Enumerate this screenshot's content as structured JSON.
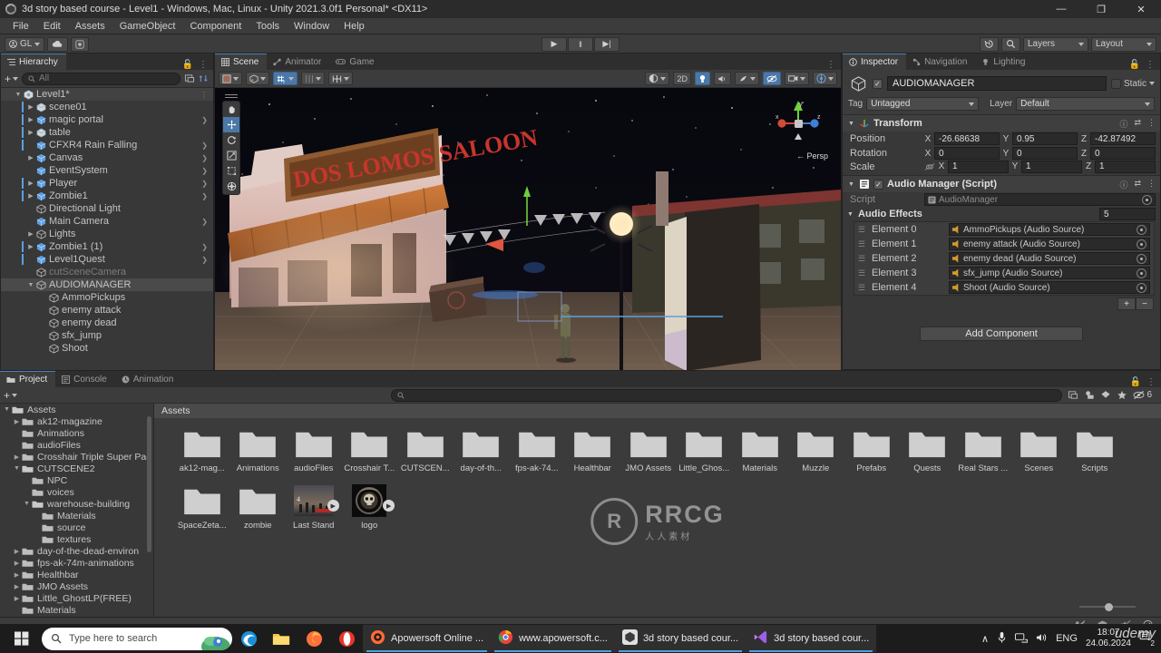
{
  "window": {
    "title": "3d story based course - Level1 - Windows, Mac, Linux - Unity 2021.3.0f1 Personal* <DX11>",
    "minimize": "—",
    "maximize": "❐",
    "close": "✕"
  },
  "menubar": [
    "File",
    "Edit",
    "Assets",
    "GameObject",
    "Component",
    "Tools",
    "Window",
    "Help"
  ],
  "toolbar": {
    "account": "GL",
    "cloud_icon": "cloud-icon",
    "services_icon": "services-icon",
    "play": "▶",
    "pause": "‖",
    "step": "▶|",
    "history_icon": "history-icon",
    "search_icon": "search-icon",
    "layers": "Layers",
    "layout": "Layout"
  },
  "hierarchy": {
    "tab": "Hierarchy",
    "tab_icon": "hierarchy-icon",
    "add_label": "+",
    "search_placeholder": "All",
    "items": [
      {
        "label": "Level1*",
        "depth": 0,
        "icon": "scene-icon",
        "arrow": "▼",
        "selected": false,
        "root": true,
        "chevron": false,
        "prefab": false,
        "dim": false,
        "bluebar": false
      },
      {
        "label": "scene01",
        "depth": 1,
        "icon": "prefab-icon",
        "arrow": "▶",
        "selected": false,
        "chevron": false,
        "prefab": true,
        "dim": false,
        "bluebar": true
      },
      {
        "label": "magic portal",
        "depth": 1,
        "icon": "gameobject-icon",
        "arrow": "▶",
        "selected": false,
        "chevron": true,
        "prefab": false,
        "dim": false,
        "bluebar": true
      },
      {
        "label": "table",
        "depth": 1,
        "icon": "prefab-icon",
        "arrow": "▶",
        "selected": false,
        "chevron": false,
        "prefab": true,
        "dim": false,
        "bluebar": true
      },
      {
        "label": "CFXR4 Rain Falling",
        "depth": 1,
        "icon": "gameobject-icon",
        "arrow": "",
        "selected": false,
        "chevron": true,
        "prefab": false,
        "dim": false,
        "bluebar": true
      },
      {
        "label": "Canvas",
        "depth": 1,
        "icon": "gameobject-icon",
        "arrow": "▶",
        "selected": false,
        "chevron": true,
        "prefab": false,
        "dim": false,
        "bluebar": false
      },
      {
        "label": "EventSystem",
        "depth": 1,
        "icon": "gameobject-icon",
        "arrow": "",
        "selected": false,
        "chevron": true,
        "prefab": false,
        "dim": false,
        "bluebar": false
      },
      {
        "label": "Player",
        "depth": 1,
        "icon": "gameobject-icon",
        "arrow": "▶",
        "selected": false,
        "chevron": true,
        "prefab": false,
        "dim": false,
        "bluebar": true
      },
      {
        "label": "Zombie1",
        "depth": 1,
        "icon": "gameobject-icon",
        "arrow": "▶",
        "selected": false,
        "chevron": true,
        "prefab": false,
        "dim": false,
        "bluebar": true
      },
      {
        "label": "Directional Light",
        "depth": 1,
        "icon": "empty-icon",
        "arrow": "",
        "selected": false,
        "chevron": false,
        "prefab": false,
        "dim": false,
        "bluebar": false
      },
      {
        "label": "Main Camera",
        "depth": 1,
        "icon": "gameobject-icon",
        "arrow": "",
        "selected": false,
        "chevron": true,
        "prefab": false,
        "dim": false,
        "bluebar": false
      },
      {
        "label": "Lights",
        "depth": 1,
        "icon": "empty-icon",
        "arrow": "▶",
        "selected": false,
        "chevron": false,
        "prefab": false,
        "dim": false,
        "bluebar": false
      },
      {
        "label": "Zombie1 (1)",
        "depth": 1,
        "icon": "gameobject-icon",
        "arrow": "▶",
        "selected": false,
        "chevron": true,
        "prefab": false,
        "dim": false,
        "bluebar": true
      },
      {
        "label": "Level1Quest",
        "depth": 1,
        "icon": "gameobject-icon",
        "arrow": "",
        "selected": false,
        "chevron": true,
        "prefab": false,
        "dim": false,
        "bluebar": true
      },
      {
        "label": "cutSceneCamera",
        "depth": 1,
        "icon": "empty-icon",
        "arrow": "",
        "selected": false,
        "chevron": false,
        "prefab": false,
        "dim": true,
        "bluebar": false
      },
      {
        "label": "AUDIOMANAGER",
        "depth": 1,
        "icon": "empty-icon",
        "arrow": "▼",
        "selected": true,
        "chevron": false,
        "prefab": false,
        "dim": false,
        "bluebar": false
      },
      {
        "label": "AmmoPickups",
        "depth": 2,
        "icon": "empty-icon",
        "arrow": "",
        "selected": false,
        "chevron": false,
        "prefab": false,
        "dim": false,
        "bluebar": false
      },
      {
        "label": "enemy attack",
        "depth": 2,
        "icon": "empty-icon",
        "arrow": "",
        "selected": false,
        "chevron": false,
        "prefab": false,
        "dim": false,
        "bluebar": false
      },
      {
        "label": "enemy dead",
        "depth": 2,
        "icon": "empty-icon",
        "arrow": "",
        "selected": false,
        "chevron": false,
        "prefab": false,
        "dim": false,
        "bluebar": false
      },
      {
        "label": "sfx_jump",
        "depth": 2,
        "icon": "empty-icon",
        "arrow": "",
        "selected": false,
        "chevron": false,
        "prefab": false,
        "dim": false,
        "bluebar": false
      },
      {
        "label": "Shoot",
        "depth": 2,
        "icon": "empty-icon",
        "arrow": "",
        "selected": false,
        "chevron": false,
        "prefab": false,
        "dim": false,
        "bluebar": false
      }
    ]
  },
  "scene": {
    "tabs": [
      {
        "label": "Scene",
        "active": true,
        "icon": "scene-tab-icon"
      },
      {
        "label": "Animator",
        "active": false,
        "icon": "animator-tab-icon"
      },
      {
        "label": "Game",
        "active": false,
        "icon": "game-tab-icon"
      }
    ],
    "toolbar": {
      "shading_mode": "shaded-icon",
      "draw_mode": "draw-mode-icon",
      "lighting_toggle": "lighting-icon",
      "audio_toggle": "audio-icon",
      "fx_toggle": "fx-icon",
      "grid_toggle": "grid-icon",
      "two_d": "2D",
      "gizmos": "Gizmos"
    },
    "tools": [
      {
        "icon": "hand-tool",
        "active": false
      },
      {
        "icon": "move-tool",
        "active": true
      },
      {
        "icon": "rotate-tool",
        "active": false
      },
      {
        "icon": "scale-tool",
        "active": false
      },
      {
        "icon": "rect-tool",
        "active": false
      },
      {
        "icon": "transform-tool",
        "active": false
      }
    ],
    "gizmo": {
      "x": "x",
      "y": "y",
      "z": "z",
      "perspective_label": "← Persp"
    },
    "signboard_text": "DOS LOMOS SALOON"
  },
  "inspector": {
    "tabs": [
      {
        "label": "Inspector",
        "active": true,
        "icon": "inspector-icon"
      },
      {
        "label": "Navigation",
        "active": false,
        "icon": "navigation-icon"
      },
      {
        "label": "Lighting",
        "active": false,
        "icon": "lighting-icon"
      }
    ],
    "object_name": "AUDIOMANAGER",
    "static_label": "Static",
    "tag_label": "Tag",
    "tag_value": "Untagged",
    "layer_label": "Layer",
    "layer_value": "Default",
    "transform": {
      "title": "Transform",
      "rows": [
        {
          "label": "Position",
          "x": "-26.68638",
          "y": "0.95",
          "z": "-42.87492"
        },
        {
          "label": "Rotation",
          "x": "0",
          "y": "0",
          "z": "0"
        },
        {
          "label": "Scale",
          "x": "1",
          "y": "1",
          "z": "1"
        }
      ]
    },
    "script_component": {
      "title": "Audio Manager (Script)",
      "script_label": "Script",
      "script_value": "AudioManager",
      "array_label": "Audio Effects",
      "array_size": "5",
      "elements": [
        {
          "label": "Element 0",
          "value": "AmmoPickups (Audio Source)"
        },
        {
          "label": "Element 1",
          "value": "enemy attack (Audio Source)"
        },
        {
          "label": "Element 2",
          "value": "enemy dead (Audio Source)"
        },
        {
          "label": "Element 3",
          "value": "sfx_jump (Audio Source)"
        },
        {
          "label": "Element 4",
          "value": "Shoot (Audio Source)"
        }
      ],
      "add_btn": "+",
      "remove_btn": "−"
    },
    "add_component": "Add Component"
  },
  "project": {
    "tabs": [
      {
        "label": "Project",
        "active": true,
        "icon": "project-icon"
      },
      {
        "label": "Console",
        "active": false,
        "icon": "console-icon"
      },
      {
        "label": "Animation",
        "active": false,
        "icon": "animation-icon"
      }
    ],
    "add_label": "+",
    "search_placeholder": "",
    "filter_count": "6",
    "breadcrumb": "Assets",
    "tree": [
      {
        "label": "Assets",
        "depth": 0,
        "arrow": "▼",
        "open": true
      },
      {
        "label": "ak12-magazine",
        "depth": 1,
        "arrow": "▶",
        "open": false
      },
      {
        "label": "Animations",
        "depth": 1,
        "arrow": "",
        "open": false
      },
      {
        "label": "audioFiles",
        "depth": 1,
        "arrow": "",
        "open": false
      },
      {
        "label": "Crosshair Triple Super Pac",
        "depth": 1,
        "arrow": "▶",
        "open": false
      },
      {
        "label": "CUTSCENE2",
        "depth": 1,
        "arrow": "▼",
        "open": true
      },
      {
        "label": "NPC",
        "depth": 2,
        "arrow": "",
        "open": false
      },
      {
        "label": "voices",
        "depth": 2,
        "arrow": "",
        "open": false
      },
      {
        "label": "warehouse-building",
        "depth": 2,
        "arrow": "▼",
        "open": true
      },
      {
        "label": "Materials",
        "depth": 3,
        "arrow": "",
        "open": false
      },
      {
        "label": "source",
        "depth": 3,
        "arrow": "",
        "open": false
      },
      {
        "label": "textures",
        "depth": 3,
        "arrow": "",
        "open": false
      },
      {
        "label": "day-of-the-dead-environ",
        "depth": 1,
        "arrow": "▶",
        "open": false
      },
      {
        "label": "fps-ak-74m-animations",
        "depth": 1,
        "arrow": "▶",
        "open": false
      },
      {
        "label": "Healthbar",
        "depth": 1,
        "arrow": "▶",
        "open": false
      },
      {
        "label": "JMO Assets",
        "depth": 1,
        "arrow": "▶",
        "open": false
      },
      {
        "label": "Little_GhostLP(FREE)",
        "depth": 1,
        "arrow": "▶",
        "open": false
      },
      {
        "label": "Materials",
        "depth": 1,
        "arrow": "",
        "open": false
      }
    ],
    "assets": [
      {
        "label": "ak12-mag...",
        "type": "folder"
      },
      {
        "label": "Animations",
        "type": "folder"
      },
      {
        "label": "audioFiles",
        "type": "folder"
      },
      {
        "label": "Crosshair T...",
        "type": "folder"
      },
      {
        "label": "CUTSCEN...",
        "type": "folder"
      },
      {
        "label": "day-of-th...",
        "type": "folder"
      },
      {
        "label": "fps-ak-74...",
        "type": "folder"
      },
      {
        "label": "Healthbar",
        "type": "folder"
      },
      {
        "label": "JMO Assets",
        "type": "folder"
      },
      {
        "label": "Little_Ghos...",
        "type": "folder"
      },
      {
        "label": "Materials",
        "type": "folder"
      },
      {
        "label": "Muzzle",
        "type": "folder"
      },
      {
        "label": "Prefabs",
        "type": "folder"
      },
      {
        "label": "Quests",
        "type": "folder"
      },
      {
        "label": "Real Stars ...",
        "type": "folder"
      },
      {
        "label": "Scenes",
        "type": "folder"
      },
      {
        "label": "Scripts",
        "type": "folder"
      },
      {
        "label": "SpaceZeta...",
        "type": "folder"
      },
      {
        "label": "zombie",
        "type": "folder"
      },
      {
        "label": "Last Stand",
        "type": "video-thumb"
      },
      {
        "label": "logo",
        "type": "image-thumb"
      }
    ],
    "watermark": {
      "brand": "RRCG",
      "sub": "人人素材"
    }
  },
  "statusbar": {
    "icons": [
      "collab-icon",
      "layers-status-icon",
      "mute-icon",
      "check-icon"
    ]
  },
  "taskbar": {
    "start_icon": "windows-start-icon",
    "search_placeholder": "Type here to search",
    "pinned": [
      "edge-icon",
      "file-explorer-icon",
      "firefox-icon",
      "opera-icon"
    ],
    "tasks": [
      {
        "label": "Apowersoft Online ...",
        "icon": "apowersoft-icon",
        "active": true
      },
      {
        "label": "www.apowersoft.c...",
        "icon": "chrome-icon",
        "active": true
      },
      {
        "label": "3d story based cour...",
        "icon": "unity-icon",
        "active": true
      },
      {
        "label": "3d story based cour...",
        "icon": "vscode-icon",
        "active": true
      }
    ],
    "tray": {
      "chevron": "∧",
      "mic": "mic-icon",
      "network": "network-icon",
      "volume": "volume-icon",
      "language": "ENG",
      "time": "18:07",
      "date": "24.06.2024",
      "notifications": "2"
    },
    "brand_watermark": "udemy"
  }
}
